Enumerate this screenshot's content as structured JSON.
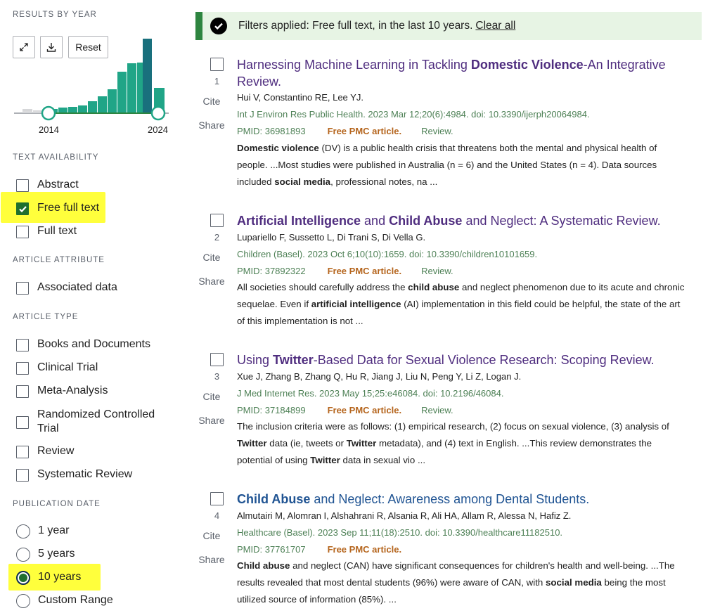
{
  "sidebar": {
    "results_by_year": {
      "title": "RESULTS BY YEAR",
      "reset_label": "Reset",
      "start_year": "2014",
      "end_year": "2024",
      "bar_color": "#20a587"
    },
    "text_availability": {
      "title": "TEXT AVAILABILITY",
      "options": [
        {
          "label": "Abstract",
          "checked": false
        },
        {
          "label": "Free full text",
          "checked": true
        },
        {
          "label": "Full text",
          "checked": false
        }
      ]
    },
    "article_attribute": {
      "title": "ARTICLE ATTRIBUTE",
      "options": [
        {
          "label": "Associated data",
          "checked": false
        }
      ]
    },
    "article_type": {
      "title": "ARTICLE TYPE",
      "options": [
        {
          "label": "Books and Documents",
          "checked": false
        },
        {
          "label": "Clinical Trial",
          "checked": false
        },
        {
          "label": "Meta-Analysis",
          "checked": false
        },
        {
          "label": "Randomized Controlled Trial",
          "checked": false
        },
        {
          "label": "Review",
          "checked": false
        },
        {
          "label": "Systematic Review",
          "checked": false
        }
      ]
    },
    "publication_date": {
      "title": "PUBLICATION DATE",
      "options": [
        {
          "label": "1 year",
          "selected": false
        },
        {
          "label": "5 years",
          "selected": false
        },
        {
          "label": "10 years",
          "selected": true
        },
        {
          "label": "Custom Range",
          "selected": false
        }
      ]
    }
  },
  "banner": {
    "text": "Filters applied: Free full text, in the last 10 years.",
    "clear_label": "Clear all"
  },
  "results": [
    {
      "number": "1",
      "title_parts": [
        {
          "text": "Harnessing Machine Learning in Tackling ",
          "bold": false
        },
        {
          "text": "Domestic Violence",
          "bold": true
        },
        {
          "text": "-An Integrative Review.",
          "bold": false
        }
      ],
      "authors": "Hui V, Constantino RE, Lee YJ.",
      "journal": "Int J Environ Res Public Health. 2023 Mar 12;20(6):4984. doi: 10.3390/ijerph20064984.",
      "pmid": "PMID: 36981893",
      "pmc": "Free PMC article.",
      "review": "Review.",
      "snippet_parts": [
        {
          "text": "Domestic violence",
          "bold": true
        },
        {
          "text": " (DV) is a public health crisis that threatens both the mental and physical health of people. ...Most studies were published in Australia (n = 6) and the United States (n = 4). Data sources included ",
          "bold": false
        },
        {
          "text": "social media",
          "bold": true
        },
        {
          "text": ", professional notes, na ...",
          "bold": false
        }
      ]
    },
    {
      "number": "2",
      "title_parts": [
        {
          "text": "Artificial Intelligence",
          "bold": true
        },
        {
          "text": " and ",
          "bold": false
        },
        {
          "text": "Child Abuse",
          "bold": true
        },
        {
          "text": " and Neglect: A Systematic Review.",
          "bold": false
        }
      ],
      "authors": "Lupariello F, Sussetto L, Di Trani S, Di Vella G.",
      "journal": "Children (Basel). 2023 Oct 6;10(10):1659. doi: 10.3390/children10101659.",
      "pmid": "PMID: 37892322",
      "pmc": "Free PMC article.",
      "review": "Review.",
      "snippet_parts": [
        {
          "text": "All societies should carefully address the ",
          "bold": false
        },
        {
          "text": "child abuse",
          "bold": true
        },
        {
          "text": " and neglect phenomenon due to its acute and chronic sequelae. Even if ",
          "bold": false
        },
        {
          "text": "artificial intelligence",
          "bold": true
        },
        {
          "text": " (AI) implementation in this field could be helpful, the state of the art of this implementation is not ...",
          "bold": false
        }
      ]
    },
    {
      "number": "3",
      "title_parts": [
        {
          "text": "Using ",
          "bold": false
        },
        {
          "text": "Twitter",
          "bold": true
        },
        {
          "text": "-Based Data for Sexual Violence Research: Scoping Review.",
          "bold": false
        }
      ],
      "authors": "Xue J, Zhang B, Zhang Q, Hu R, Jiang J, Liu N, Peng Y, Li Z, Logan J.",
      "journal": "J Med Internet Res. 2023 May 15;25:e46084. doi: 10.2196/46084.",
      "pmid": "PMID: 37184899",
      "pmc": "Free PMC article.",
      "review": "Review.",
      "snippet_parts": [
        {
          "text": "The inclusion criteria were as follows: (1) empirical research, (2) focus on sexual violence, (3) analysis of ",
          "bold": false
        },
        {
          "text": "Twitter",
          "bold": true
        },
        {
          "text": " data (ie, tweets or ",
          "bold": false
        },
        {
          "text": "Twitter",
          "bold": true
        },
        {
          "text": " metadata), and (4) text in English. ...This review demonstrates the potential of using ",
          "bold": false
        },
        {
          "text": "Twitter",
          "bold": true
        },
        {
          "text": " data in sexual vio ...",
          "bold": false
        }
      ]
    },
    {
      "number": "4",
      "title_parts": [
        {
          "text": "Child Abuse",
          "bold": true
        },
        {
          "text": " and Neglect: Awareness among Dental Students.",
          "bold": false
        }
      ],
      "authors": "Almutairi M, Alomran I, Alshahrani R, Alsania R, Ali HA, Allam R, Alessa N, Hafiz Z.",
      "journal": "Healthcare (Basel). 2023 Sep 11;11(18):2510. doi: 10.3390/healthcare11182510.",
      "pmid": "PMID: 37761707",
      "pmc": "Free PMC article.",
      "review": "",
      "snippet_parts": [
        {
          "text": "Child abuse",
          "bold": true
        },
        {
          "text": " and neglect (CAN) have significant consequences for children's health and well-being. ...The results revealed that most dental students (96%) were aware of CAN, with ",
          "bold": false
        },
        {
          "text": "social media",
          "bold": true
        },
        {
          "text": " being the most utilized source of information (85%). ...",
          "bold": false
        }
      ]
    }
  ],
  "labels": {
    "cite": "Cite",
    "share": "Share"
  },
  "colors": {
    "accent_green": "#2e8540",
    "title_purple": "#4f2d7f",
    "title_blue": "#205493",
    "journal_green": "#4d8055",
    "pmc_orange": "#b5651d",
    "highlight_yellow": "#ffff3c"
  }
}
